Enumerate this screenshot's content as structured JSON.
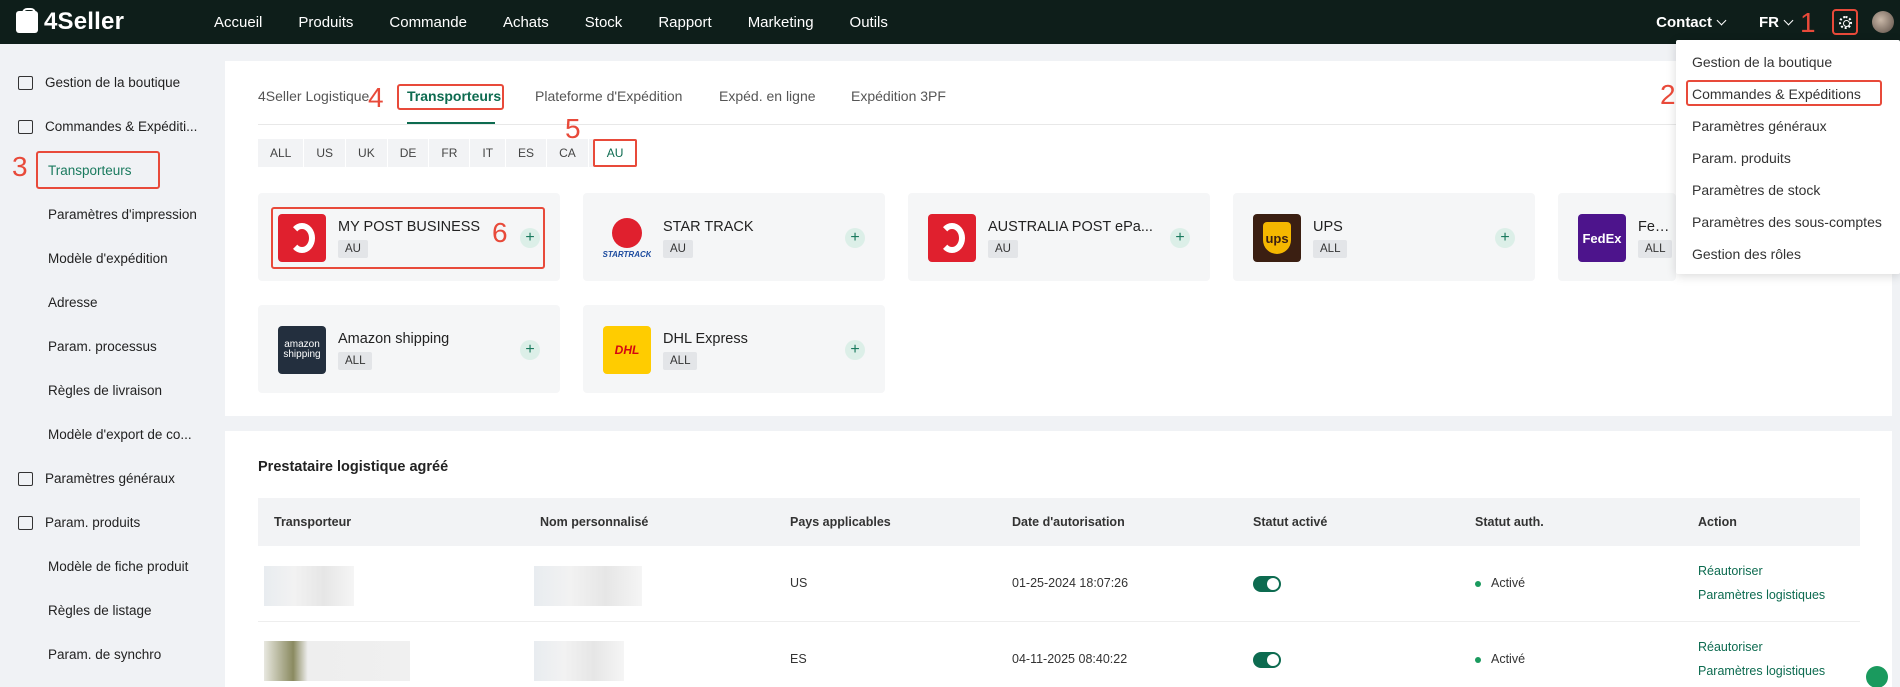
{
  "app": {
    "logo": "4Seller"
  },
  "topnav": {
    "items": [
      "Accueil",
      "Produits",
      "Commande",
      "Achats",
      "Stock",
      "Rapport",
      "Marketing",
      "Outils"
    ],
    "contact": "Contact",
    "lang": "FR"
  },
  "sidebar": {
    "groups": [
      {
        "label": "Gestion de la boutique",
        "icon": "store-icon"
      },
      {
        "label": "Commandes & Expéditi...",
        "icon": "orders-icon"
      },
      {
        "label": "Paramètres généraux",
        "icon": "printer-icon"
      },
      {
        "label": "Param. produits",
        "icon": "product-icon"
      }
    ],
    "orders_sub": [
      "Transporteurs",
      "Paramètres d'impression",
      "Modèle d'expédition",
      "Adresse",
      "Param. processus",
      "Règles de livraison",
      "Modèle d'export de co..."
    ],
    "product_sub": [
      "Modèle de fiche produit",
      "Règles de listage",
      "Param. de synchro"
    ]
  },
  "tabs": [
    "4Seller Logistique",
    "Transporteurs",
    "Plateforme d'Expédition",
    "Expéd. en ligne",
    "Expédition 3PF"
  ],
  "countries": [
    "ALL",
    "US",
    "UK",
    "DE",
    "FR",
    "IT",
    "ES",
    "CA",
    "AU"
  ],
  "carriers": [
    {
      "name": "MY POST BUSINESS",
      "tag": "AU",
      "logo": "auspost"
    },
    {
      "name": "STAR TRACK",
      "tag": "AU",
      "logo": "startrack",
      "logo_text": "STARTRACK"
    },
    {
      "name": "AUSTRALIA POST ePa...",
      "tag": "AU",
      "logo": "auspost"
    },
    {
      "name": "UPS",
      "tag": "ALL",
      "logo": "ups",
      "logo_text": "ups"
    },
    {
      "name": "FedEx",
      "tag": "ALL",
      "logo": "fedex",
      "logo_text": "FedEx"
    },
    {
      "name": "Amazon shipping",
      "tag": "ALL",
      "logo": "amazon",
      "logo_text": "amazon shipping"
    },
    {
      "name": "DHL Express",
      "tag": "ALL",
      "logo": "dhl",
      "logo_text": "DHL"
    }
  ],
  "table": {
    "title": "Prestataire logistique agréé",
    "headers": [
      "Transporteur",
      "Nom personnalisé",
      "Pays applicables",
      "Date d'autorisation",
      "Statut activé",
      "Statut auth.",
      "Action"
    ],
    "rows": [
      {
        "country": "US",
        "date": "01-25-2024 18:07:26",
        "status": "Activé",
        "actions": [
          "Réautoriser",
          "Paramètres logistiques"
        ]
      },
      {
        "country": "ES",
        "date": "04-11-2025 08:40:22",
        "status": "Activé",
        "actions": [
          "Réautoriser",
          "Paramètres logistiques"
        ]
      }
    ]
  },
  "settings_menu": [
    "Gestion de la boutique",
    "Commandes & Expéditions",
    "Paramètres généraux",
    "Param. produits",
    "Paramètres de stock",
    "Paramètres des sous-comptes",
    "Gestion des rôles"
  ],
  "annotations": [
    "1",
    "2",
    "3",
    "4",
    "5",
    "6"
  ],
  "colors": {
    "accent": "#0d6b50",
    "annotation": "#e84a3a",
    "topbar": "#0e1e1a"
  }
}
